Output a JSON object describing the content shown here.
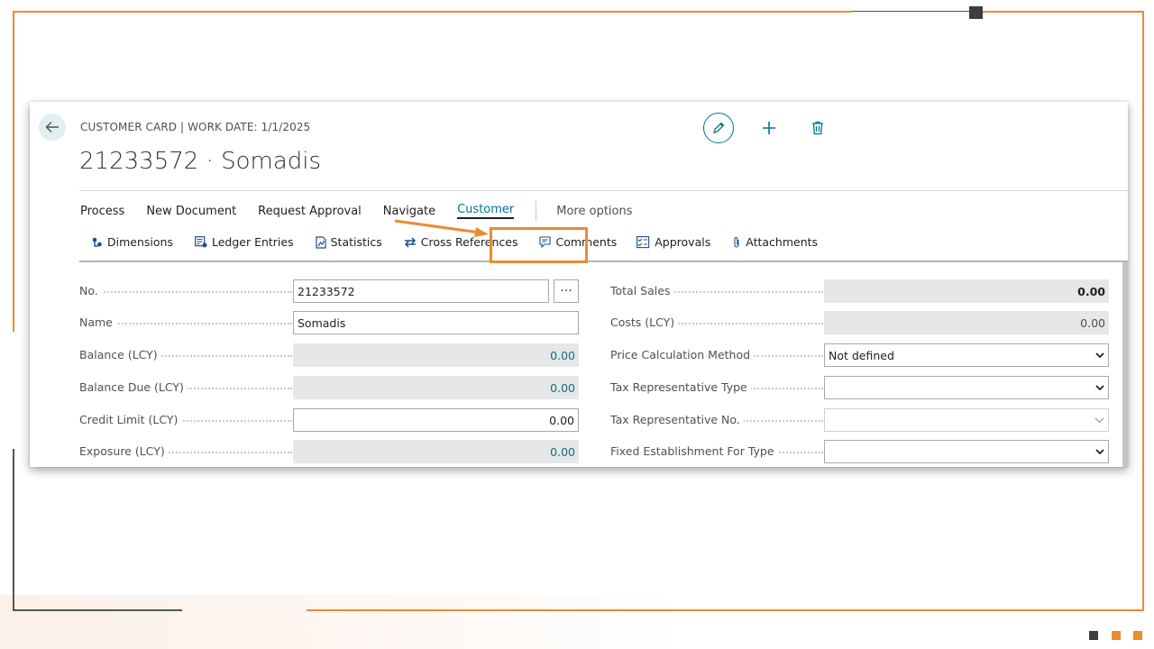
{
  "header": {
    "caption": "CUSTOMER CARD | WORK DATE: 1/1/2025",
    "title": "21233572 · Somadis"
  },
  "icons": [
    "back-arrow-icon",
    "edit-icon",
    "plus-icon",
    "delete-icon",
    "dimensions-icon",
    "ledger-entries-icon",
    "statistics-icon",
    "cross-references-icon",
    "comments-icon",
    "approvals-icon",
    "attachments-icon",
    "chevron-down-icon"
  ],
  "colors": {
    "accent": "#00758f",
    "highlight": "#ee8a2f",
    "readonly_bg": "#e6e7e8"
  },
  "action_menu": {
    "items": [
      "Process",
      "New Document",
      "Request Approval",
      "Navigate",
      "Customer"
    ],
    "active": "Customer",
    "more": "More options"
  },
  "subbar": {
    "items": [
      "Dimensions",
      "Ledger Entries",
      "Statistics",
      "Cross References",
      "Comments",
      "Approvals",
      "Attachments"
    ]
  },
  "fields_left": [
    {
      "label": "No.",
      "value": "21233572",
      "assist": "···"
    },
    {
      "label": "Name",
      "value": "Somadis"
    },
    {
      "label": "Balance (LCY)",
      "value": "0.00"
    },
    {
      "label": "Balance Due (LCY)",
      "value": "0.00"
    },
    {
      "label": "Credit Limit (LCY)",
      "value": "0.00"
    },
    {
      "label": "Exposure (LCY)",
      "value": "0.00"
    }
  ],
  "fields_right": [
    {
      "label": "Total Sales",
      "value": "0.00"
    },
    {
      "label": "Costs (LCY)",
      "value": "0.00"
    },
    {
      "label": "Price Calculation Method",
      "value": "Not defined"
    },
    {
      "label": "Tax Representative Type",
      "value": ""
    },
    {
      "label": "Tax Representative No.",
      "value": ""
    },
    {
      "label": "Fixed Establishment For Type",
      "value": ""
    }
  ]
}
